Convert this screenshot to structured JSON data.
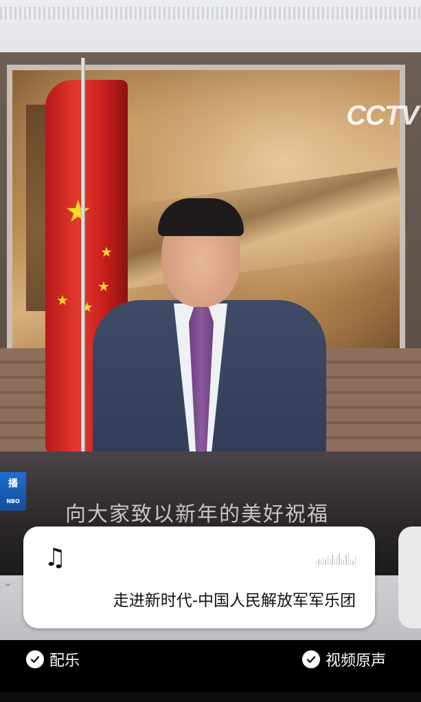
{
  "video": {
    "watermark": "CCTV",
    "subtitle": "向大家致以新年的美好祝福",
    "station_logo": {
      "main": "播",
      "sub": "NBO"
    }
  },
  "music_card": {
    "icon": "music-note-icon",
    "song_title": "走进新时代-中国人民解放军军乐团",
    "waveform_icon": "waveform-icon"
  },
  "options": {
    "music": {
      "label": "配乐",
      "checked": true
    },
    "original_sound": {
      "label": "视频原声",
      "checked": true
    }
  },
  "colors": {
    "card_bg": "#ffffff",
    "bar_bg": "#000000",
    "flag_red": "#d42a22",
    "star_yellow": "#f6d72a"
  }
}
